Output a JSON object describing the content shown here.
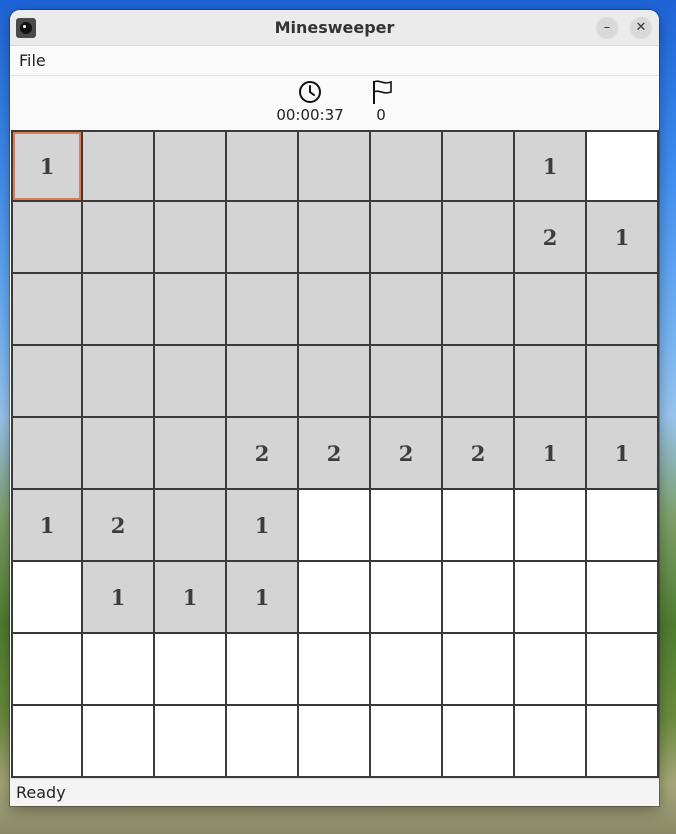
{
  "window": {
    "title": "Minesweeper",
    "minimize_label": "–",
    "close_label": "✕"
  },
  "menu": {
    "file_label": "File"
  },
  "info": {
    "timer": "00:00:37",
    "flags": "0",
    "timer_icon": "clock-icon",
    "flags_icon": "flag-icon"
  },
  "board": {
    "rows": [
      [
        {
          "state": "covered",
          "label": "1"
        },
        {
          "state": "covered",
          "label": ""
        },
        {
          "state": "covered",
          "label": ""
        },
        {
          "state": "covered",
          "label": ""
        },
        {
          "state": "covered",
          "label": ""
        },
        {
          "state": "covered",
          "label": ""
        },
        {
          "state": "covered",
          "label": ""
        },
        {
          "state": "covered",
          "label": "1"
        },
        {
          "state": "open",
          "label": ""
        }
      ],
      [
        {
          "state": "covered",
          "label": ""
        },
        {
          "state": "covered",
          "label": ""
        },
        {
          "state": "covered",
          "label": ""
        },
        {
          "state": "covered",
          "label": ""
        },
        {
          "state": "covered",
          "label": ""
        },
        {
          "state": "covered",
          "label": ""
        },
        {
          "state": "covered",
          "label": ""
        },
        {
          "state": "covered",
          "label": "2"
        },
        {
          "state": "covered",
          "label": "1"
        }
      ],
      [
        {
          "state": "covered",
          "label": ""
        },
        {
          "state": "covered",
          "label": ""
        },
        {
          "state": "covered",
          "label": ""
        },
        {
          "state": "covered",
          "label": ""
        },
        {
          "state": "covered",
          "label": ""
        },
        {
          "state": "covered",
          "label": ""
        },
        {
          "state": "covered",
          "label": ""
        },
        {
          "state": "covered",
          "label": ""
        },
        {
          "state": "covered",
          "label": ""
        }
      ],
      [
        {
          "state": "covered",
          "label": ""
        },
        {
          "state": "covered",
          "label": ""
        },
        {
          "state": "covered",
          "label": ""
        },
        {
          "state": "covered",
          "label": ""
        },
        {
          "state": "covered",
          "label": ""
        },
        {
          "state": "covered",
          "label": ""
        },
        {
          "state": "covered",
          "label": ""
        },
        {
          "state": "covered",
          "label": ""
        },
        {
          "state": "covered",
          "label": ""
        }
      ],
      [
        {
          "state": "covered",
          "label": ""
        },
        {
          "state": "covered",
          "label": ""
        },
        {
          "state": "covered",
          "label": ""
        },
        {
          "state": "covered",
          "label": "2"
        },
        {
          "state": "covered",
          "label": "2"
        },
        {
          "state": "covered",
          "label": "2"
        },
        {
          "state": "covered",
          "label": "2"
        },
        {
          "state": "covered",
          "label": "1"
        },
        {
          "state": "covered",
          "label": "1"
        }
      ],
      [
        {
          "state": "covered",
          "label": "1"
        },
        {
          "state": "covered",
          "label": "2"
        },
        {
          "state": "covered",
          "label": ""
        },
        {
          "state": "covered",
          "label": "1"
        },
        {
          "state": "open",
          "label": ""
        },
        {
          "state": "open",
          "label": ""
        },
        {
          "state": "open",
          "label": ""
        },
        {
          "state": "open",
          "label": ""
        },
        {
          "state": "open",
          "label": ""
        }
      ],
      [
        {
          "state": "open",
          "label": ""
        },
        {
          "state": "covered",
          "label": "1"
        },
        {
          "state": "covered",
          "label": "1"
        },
        {
          "state": "covered",
          "label": "1"
        },
        {
          "state": "open",
          "label": ""
        },
        {
          "state": "open",
          "label": ""
        },
        {
          "state": "open",
          "label": ""
        },
        {
          "state": "open",
          "label": ""
        },
        {
          "state": "open",
          "label": ""
        }
      ],
      [
        {
          "state": "open",
          "label": ""
        },
        {
          "state": "open",
          "label": ""
        },
        {
          "state": "open",
          "label": ""
        },
        {
          "state": "open",
          "label": ""
        },
        {
          "state": "open",
          "label": ""
        },
        {
          "state": "open",
          "label": ""
        },
        {
          "state": "open",
          "label": ""
        },
        {
          "state": "open",
          "label": ""
        },
        {
          "state": "open",
          "label": ""
        }
      ],
      [
        {
          "state": "open",
          "label": ""
        },
        {
          "state": "open",
          "label": ""
        },
        {
          "state": "open",
          "label": ""
        },
        {
          "state": "open",
          "label": ""
        },
        {
          "state": "open",
          "label": ""
        },
        {
          "state": "open",
          "label": ""
        },
        {
          "state": "open",
          "label": ""
        },
        {
          "state": "open",
          "label": ""
        },
        {
          "state": "open",
          "label": ""
        }
      ]
    ],
    "focused_row": 0,
    "focused_col": 0,
    "colors": {
      "covered": "#d4d4d4",
      "open": "#ffffff",
      "grid": "#3a3a3a",
      "focus": "#e07a55"
    }
  },
  "status": {
    "text": "Ready"
  }
}
